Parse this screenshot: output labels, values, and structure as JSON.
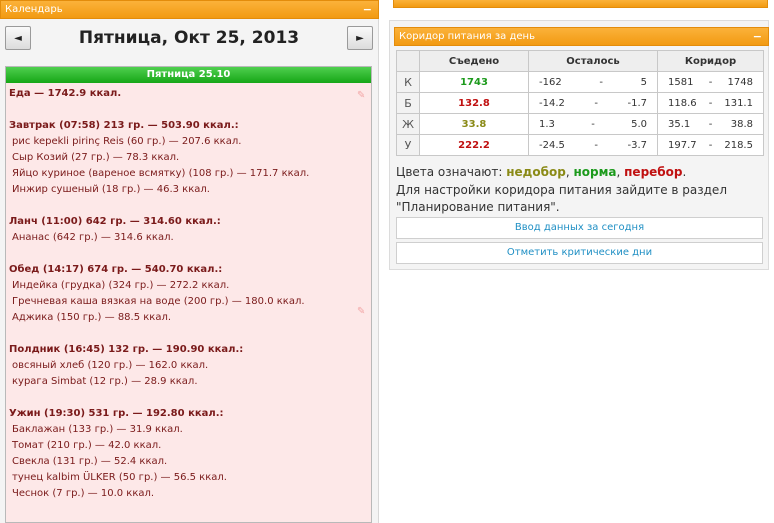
{
  "calendar": {
    "panel_title": "Календарь",
    "collapse_symbol": "−",
    "prev_symbol": "◄",
    "next_symbol": "►",
    "date_title": "Пятница, Окт 25, 2013",
    "day_header": "Пятница 25.10",
    "food_total": "Еда — 1742.9 ккал.",
    "meals": [
      {
        "header": "Завтрак (07:58) 213 гр. — 503.90 ккал.:",
        "items": [
          "рис kepekli pirinç Reis (60 гр.) — 207.6 ккал.",
          "Сыр Козий (27 гр.) — 78.3 ккал.",
          "Яйцо куриное (вареное всмятку) (108 гр.) — 171.7 ккал.",
          "Инжир сушеный (18 гр.) — 46.3 ккал."
        ]
      },
      {
        "header": "Ланч (11:00) 642 гр. — 314.60 ккал.:",
        "items": [
          "Ананас (642 гр.) — 314.6 ккал."
        ]
      },
      {
        "header": "Обед (14:17) 674 гр. — 540.70 ккал.:",
        "items": [
          "Индейка (грудка) (324 гр.) — 272.2 ккал.",
          "Гречневая каша вязкая на воде (200 гр.) — 180.0 ккал.",
          "Аджика (150 гр.) — 88.5 ккал."
        ]
      },
      {
        "header": "Полдник (16:45) 132 гр. — 190.90 ккал.:",
        "items": [
          "овсяный хлеб (120 гр.) — 162.0 ккал.",
          "курага Simbat (12 гр.) — 28.9 ккал."
        ]
      },
      {
        "header": "Ужин (19:30) 531 гр. — 192.80 ккал.:",
        "items": [
          "Баклажан (133 гр.) — 31.9 ккал.",
          "Томат (210 гр.) — 42.0 ккал.",
          "Свекла (131 гр.) — 52.4 ккал.",
          "тунец kalbim ÜLKER (50 гр.) — 56.5 ккал.",
          "Чеснок (7 гр.) — 10.0 ккал."
        ]
      }
    ]
  },
  "corridor": {
    "panel_title": "Коридор питания за день",
    "collapse_symbol": "−",
    "columns": [
      "Съедено",
      "Осталось",
      "Коридор"
    ],
    "rows": [
      {
        "label": "К",
        "eaten": "1743",
        "eaten_color": "#1c9a1c",
        "left_min": "-162",
        "left_max": "5",
        "range_min": "1581",
        "range_max": "1748"
      },
      {
        "label": "Б",
        "eaten": "132.8",
        "eaten_color": "#c01010",
        "left_min": "-14.2",
        "left_max": "-1.7",
        "range_min": "118.6",
        "range_max": "131.1"
      },
      {
        "label": "Ж",
        "eaten": "33.8",
        "eaten_color": "#8a8a16",
        "left_min": "1.3",
        "left_max": "5.0",
        "range_min": "35.1",
        "range_max": "38.8"
      },
      {
        "label": "У",
        "eaten": "222.2",
        "eaten_color": "#c01010",
        "left_min": "-24.5",
        "left_max": "-3.7",
        "range_min": "197.7",
        "range_max": "218.5"
      }
    ],
    "legend": {
      "prefix": "Цвета означают: ",
      "under": "недобор",
      "norm": "норма",
      "over": "перебор"
    },
    "info": "Для настройки коридора питания зайдите в раздел \"Планирование питания\".",
    "btn_enter": "Ввод данных за сегодня",
    "btn_critical": "Отметить критические дни"
  }
}
